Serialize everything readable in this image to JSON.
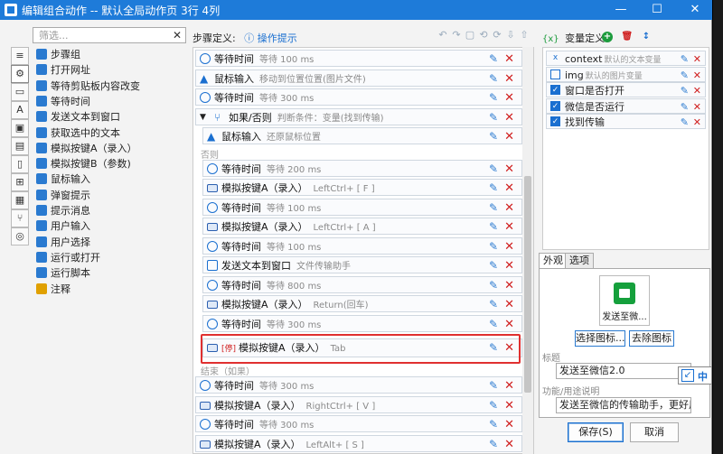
{
  "window": {
    "title": "编辑组合动作 -- 默认全局动作页 3行 4列",
    "controls": {
      "minimize": "—",
      "maximize": "☐",
      "close": "✕"
    }
  },
  "library": {
    "search_placeholder": "筛选...",
    "clear": "✕",
    "items": [
      {
        "label": "步骤组",
        "icon": "step-group-icon",
        "color": "#2a7ad0"
      },
      {
        "label": "打开网址",
        "icon": "globe-icon",
        "color": "#2a7ad0"
      },
      {
        "label": "等待剪贴板内容改变",
        "icon": "clipboard-clock-icon",
        "color": "#2a7ad0"
      },
      {
        "label": "等待时间",
        "icon": "clock-icon",
        "color": "#2a7ad0"
      },
      {
        "label": "发送文本到窗口",
        "icon": "send-text-icon",
        "color": "#2a7ad0"
      },
      {
        "label": "获取选中的文本",
        "icon": "text-cursor-icon",
        "color": "#2a7ad0"
      },
      {
        "label": "模拟按键A（录入）",
        "icon": "keyboard-icon",
        "color": "#2a7ad0"
      },
      {
        "label": "模拟按键B（参数)",
        "icon": "keyboard-icon",
        "color": "#2a7ad0"
      },
      {
        "label": "鼠标输入",
        "icon": "mouse-cursor-icon",
        "color": "#2a7ad0"
      },
      {
        "label": "弹窗提示",
        "icon": "popup-icon",
        "color": "#2a7ad0"
      },
      {
        "label": "提示消息",
        "icon": "message-icon",
        "color": "#2a7ad0"
      },
      {
        "label": "用户输入",
        "icon": "user-input-icon",
        "color": "#2a7ad0"
      },
      {
        "label": "用户选择",
        "icon": "user-select-icon",
        "color": "#2a7ad0"
      },
      {
        "label": "运行或打开",
        "icon": "paper-plane-icon",
        "color": "#2a7ad0"
      },
      {
        "label": "运行脚本",
        "icon": "script-icon",
        "color": "#2a7ad0"
      },
      {
        "label": "注释",
        "icon": "note-icon",
        "color": "#e0a000"
      }
    ]
  },
  "strip": [
    {
      "name": "menu-icon",
      "glyph": "≡"
    },
    {
      "name": "gear-icon",
      "glyph": "⚙"
    },
    {
      "name": "window-icon",
      "glyph": "▭"
    },
    {
      "name": "font-icon",
      "glyph": "A"
    },
    {
      "name": "image-icon",
      "glyph": "▣"
    },
    {
      "name": "clipboard-icon",
      "glyph": "▤"
    },
    {
      "name": "file-icon",
      "glyph": "▯"
    },
    {
      "name": "windows-icon",
      "glyph": "⊞"
    },
    {
      "name": "grid-icon",
      "glyph": "▦"
    },
    {
      "name": "branch-icon",
      "glyph": "⑂"
    },
    {
      "name": "globe-icon",
      "glyph": "◎"
    }
  ],
  "steps_panel": {
    "label": "步骤定义:",
    "hint": "ⓘ 操作提示",
    "tools": [
      "↶",
      "↷",
      "▢",
      "⟲",
      "⟳",
      "⇩",
      "⇧"
    ],
    "else_label": "否则",
    "end_label": "结束（如果）",
    "rows": [
      {
        "kind": "clock",
        "label": "等待时间",
        "desc": "等待 100 ms"
      },
      {
        "kind": "mouse",
        "label": "鼠标输入",
        "desc": "移动到位置位置(图片文件)"
      },
      {
        "kind": "clock",
        "label": "等待时间",
        "desc": "等待 300 ms"
      },
      {
        "kind": "branch",
        "label": "如果/否则",
        "desc": "判断条件：变量(找到传输)"
      },
      {
        "kind": "mouse",
        "label": "鼠标输入",
        "desc": "还原鼠标位置"
      },
      {
        "kind": "clock",
        "label": "等待时间",
        "desc": "等待 200 ms"
      },
      {
        "kind": "kb",
        "label": "模拟按键A（录入）",
        "desc": "LeftCtrl+ [ F ]"
      },
      {
        "kind": "clock",
        "label": "等待时间",
        "desc": "等待 100 ms"
      },
      {
        "kind": "kb",
        "label": "模拟按键A（录入）",
        "desc": "LeftCtrl+ [ A ]"
      },
      {
        "kind": "clock",
        "label": "等待时间",
        "desc": "等待 100 ms"
      },
      {
        "kind": "send",
        "label": "发送文本到窗口",
        "desc": "文件传输助手"
      },
      {
        "kind": "clock",
        "label": "等待时间",
        "desc": "等待 800 ms"
      },
      {
        "kind": "kb",
        "label": "模拟按键A（录入）",
        "desc": "Return(回车)"
      },
      {
        "kind": "clock",
        "label": "等待时间",
        "desc": "等待 300 ms"
      },
      {
        "kind": "kb",
        "label": "模拟按键A（录入）",
        "desc": "Tab",
        "prefix": "[停]"
      },
      {
        "kind": "clock",
        "label": "等待时间",
        "desc": "等待 300 ms"
      },
      {
        "kind": "kb",
        "label": "模拟按键A（录入）",
        "desc": "RightCtrl+ [ V ]"
      },
      {
        "kind": "clock",
        "label": "等待时间",
        "desc": "等待 300 ms"
      },
      {
        "kind": "kb",
        "label": "模拟按键A（录入）",
        "desc": "LeftAlt+ [ S ]"
      }
    ]
  },
  "variables": {
    "label": "变量定义",
    "badge": "{x}",
    "add": "+",
    "trash": "🗑",
    "sort": "↕",
    "rows": [
      {
        "name": "context",
        "desc": "默认的文本变量",
        "type": "x"
      },
      {
        "name": "img",
        "desc": "默认的图片变量",
        "type": "img"
      },
      {
        "name": "窗口是否打开",
        "desc": "",
        "type": "bool"
      },
      {
        "name": "微信是否运行",
        "desc": "",
        "type": "bool"
      },
      {
        "name": "找到传输",
        "desc": "",
        "type": "bool"
      }
    ]
  },
  "appearance": {
    "tabs": [
      "外观",
      "选项"
    ],
    "icon_label": "发送至微...",
    "choose_icon": "选择图标...",
    "remove_icon": "去除图标",
    "title_label": "标题",
    "title_value": "发送至微信2.0",
    "desc_label": "功能/用途说明",
    "desc_value": "发送至微信的传输助手，更好用"
  },
  "ime": {
    "mode": "中",
    "icon": "↙"
  },
  "footer": {
    "save": "保存(S)",
    "cancel": "取消"
  },
  "colors": {
    "accent": "#1e7bd9",
    "delete": "#d02020",
    "highlight": "#e03030"
  }
}
